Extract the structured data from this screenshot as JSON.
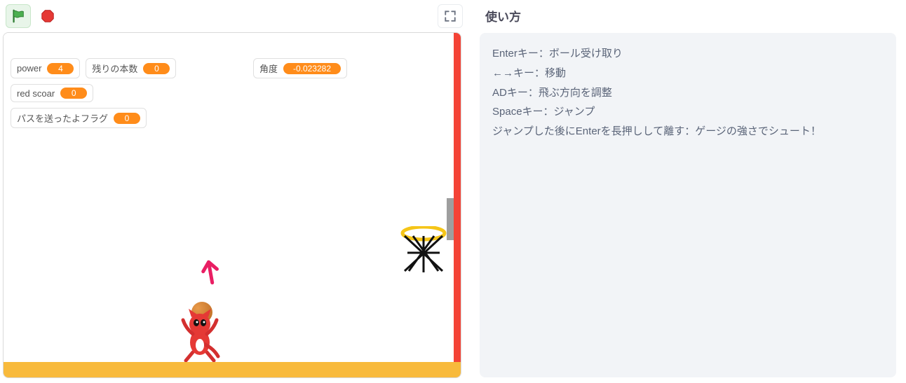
{
  "controls": {
    "flag_icon": "flag-icon",
    "stop_icon": "stop-icon",
    "expand_icon": "expand-icon"
  },
  "variables": {
    "power_label": "power",
    "power_value": "4",
    "remaining_label": "残りの本数",
    "remaining_value": "0",
    "redscoar_label": "red scoar",
    "redscoar_value": "0",
    "pass_flag_label": "パスを送ったよフラグ",
    "pass_flag_value": "0",
    "angle_label": "角度",
    "angle_value": "-0.023282"
  },
  "instructions": {
    "title": "使い方",
    "lines": [
      "Enterキー：ボール受け取り",
      "←→キー：移動",
      "ADキー：飛ぶ方向を調整",
      "Spaceキー：ジャンプ",
      "ジャンプした後にEnterを長押しして離す：ゲージの強さでシュート！"
    ]
  }
}
